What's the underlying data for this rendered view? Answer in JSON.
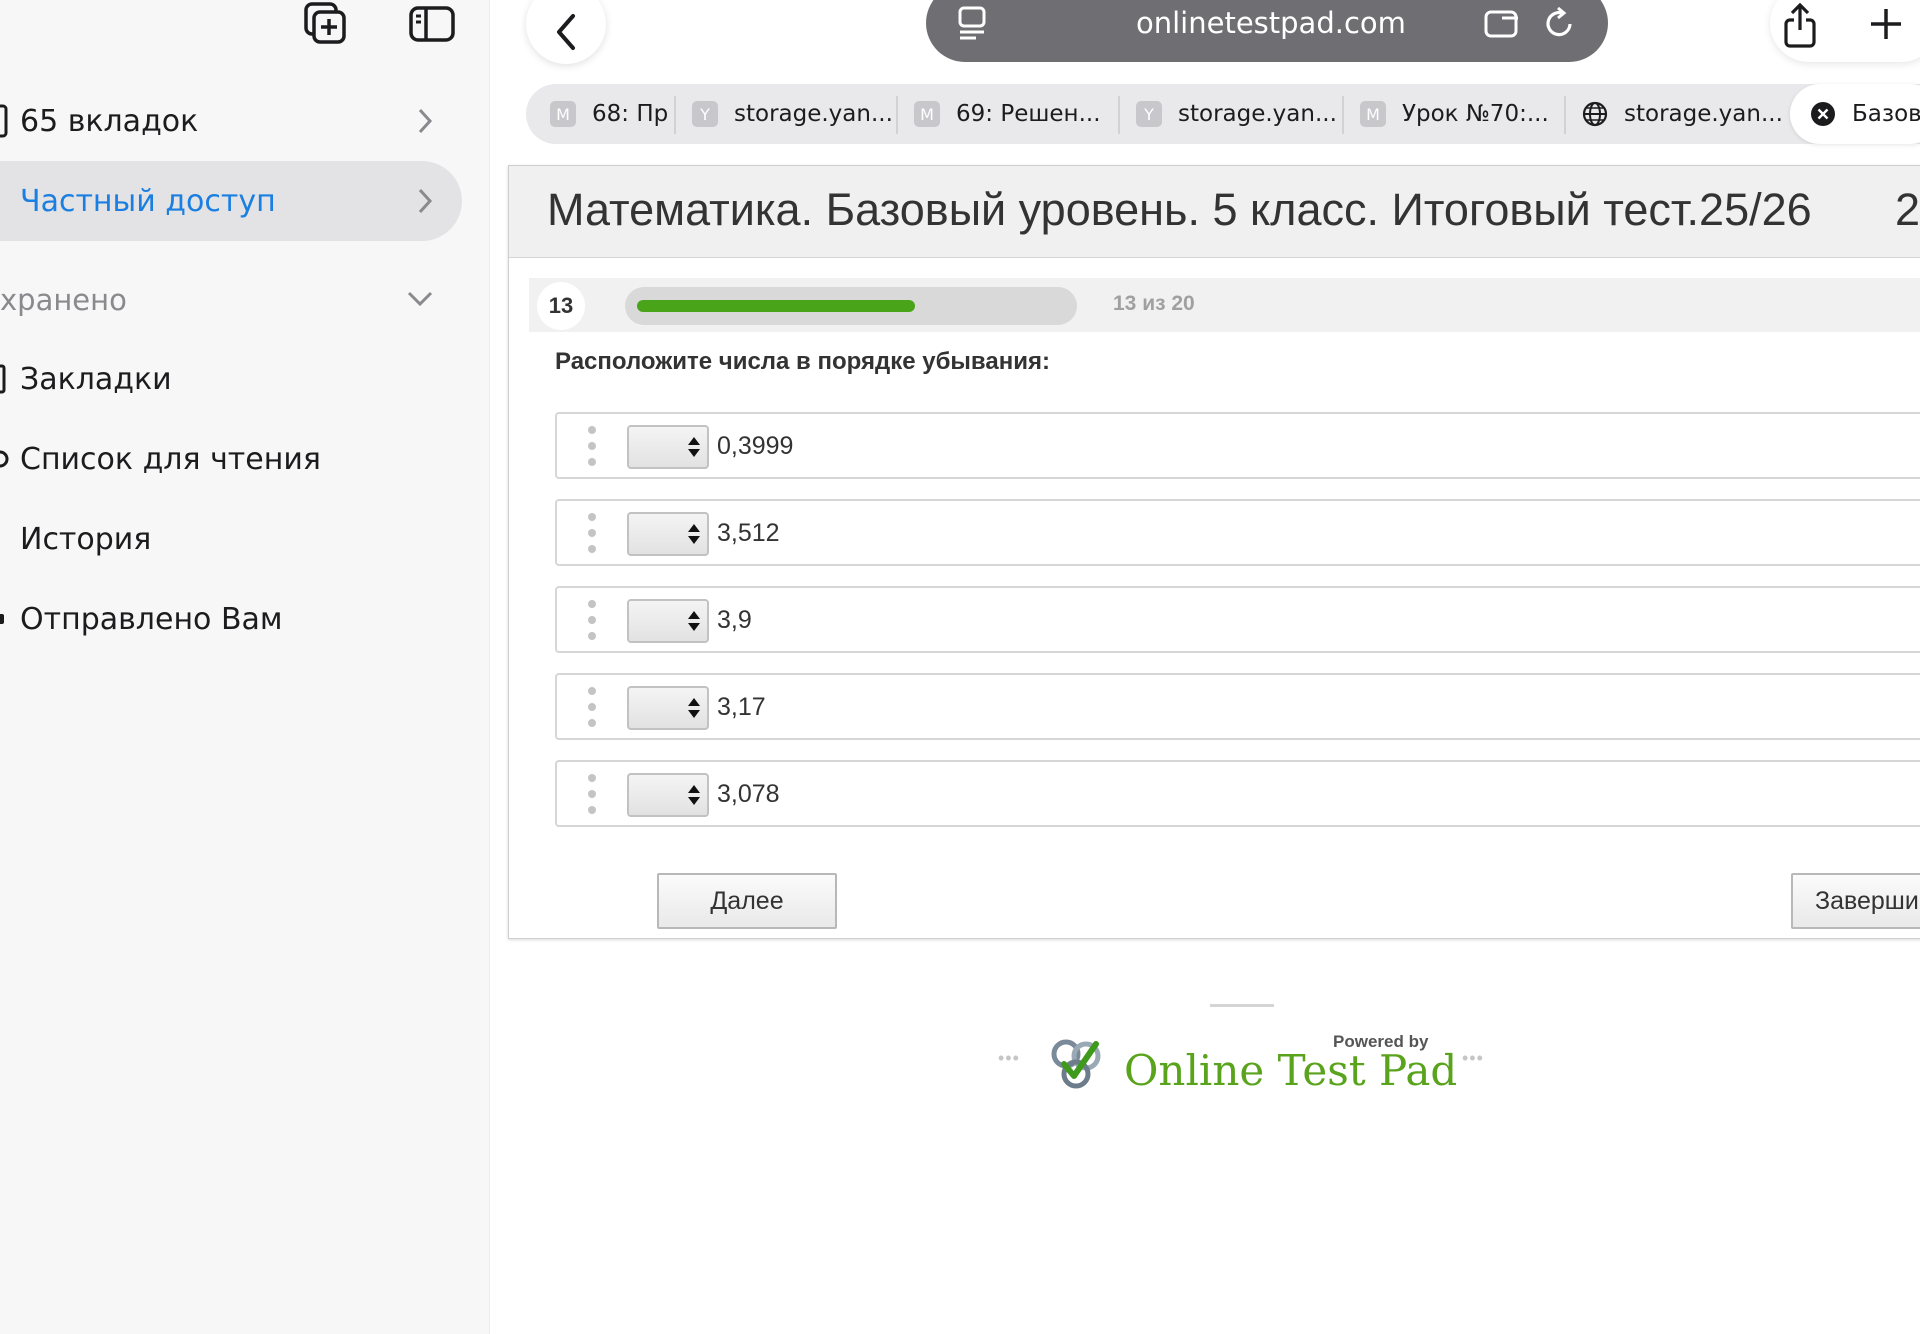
{
  "sidebar": {
    "items": [
      {
        "label": "65 вкладок"
      },
      {
        "label": "Частный доступ"
      },
      {
        "label": "Закладки"
      },
      {
        "label": "Список для чтения"
      },
      {
        "label": "История"
      },
      {
        "label": "Отправлено Вам"
      }
    ],
    "section_label": "хранено"
  },
  "toolbar": {
    "url": "onlinetestpad.com"
  },
  "tabs": [
    {
      "favicon": "M",
      "label": "68: Пр"
    },
    {
      "favicon": "Y",
      "label": "storage.yan..."
    },
    {
      "favicon": "M",
      "label": "69: Решен..."
    },
    {
      "favicon": "Y",
      "label": "storage.yan..."
    },
    {
      "favicon": "M",
      "label": "Урок №70:..."
    },
    {
      "favicon": "globe",
      "label": "storage.yan..."
    },
    {
      "favicon": "close",
      "label": "Базовы"
    }
  ],
  "test": {
    "title": "Математика. Базовый уровень. 5 класс. Итоговый тест.25/26",
    "title_overflow": "2",
    "question_number": "13",
    "progress_text": "13 из 20",
    "progress_fraction": 0.65,
    "question": "Расположите числа в порядке убывания:",
    "answers": [
      {
        "value": "0,3999"
      },
      {
        "value": "3,512"
      },
      {
        "value": "3,9"
      },
      {
        "value": "3,17"
      },
      {
        "value": "3,078"
      }
    ],
    "next_button": "Далее",
    "finish_button": "Заверши"
  },
  "footer": {
    "powered_by": "Powered by",
    "brand": "Online Test Pad"
  },
  "colors": {
    "accent_blue": "#1a7fe0",
    "progress_green": "#4aa41a",
    "brand_green": "#5aa31c"
  }
}
